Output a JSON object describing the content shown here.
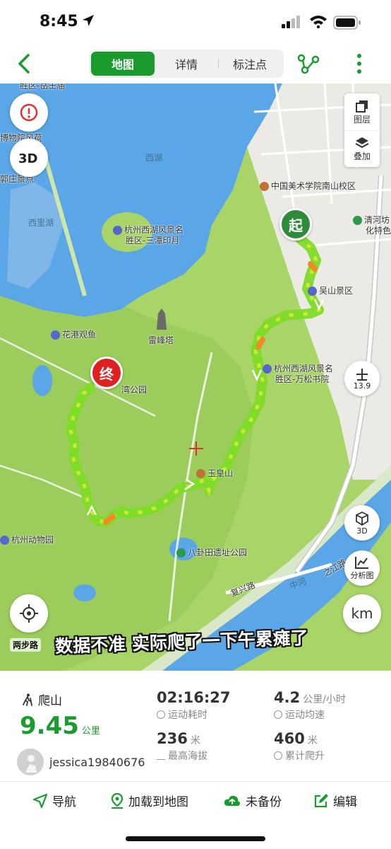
{
  "status_bar": {
    "time": "8:45"
  },
  "header": {
    "tabs": [
      {
        "label": "地图",
        "active": true
      },
      {
        "label": "详情",
        "active": false
      },
      {
        "label": "标注点",
        "active": false
      }
    ]
  },
  "map": {
    "layers_label": "图层",
    "overlay_label": "叠加",
    "zoom_level": "13.9",
    "btn_3d_label": "3D",
    "analysis_label": "分析图",
    "unit_button_label": "km",
    "start_marker": "起",
    "end_marker": "终",
    "caption": "数据不准 实际爬了一下午累瘫了",
    "brand_watermark": "两步路",
    "pois": {
      "academy": "中国美术学院南山校区",
      "wushan": "吴山景区",
      "wansong_1": "杭州西湖风景名",
      "wansong_2": "胜区-万松书院",
      "santan_1": "杭州西湖风景名",
      "santan_2": "胜区-三潭印月",
      "huagang": "花港观鱼",
      "leifeng": "雷峰塔",
      "park_partial": "湾公园",
      "yuhuang": "玉皇山",
      "bagua": "八卦田遗址公园",
      "zoo": "杭州动物园",
      "fuxing": "复兴路",
      "zhijiang": "之江路",
      "river": "中河",
      "xihu": "西湖",
      "xilihu": "西里湖",
      "qinghe_1": "清河坊",
      "qinghe_2": "化特色",
      "top_cut": "胜区-岳王庙",
      "hall_cut": "博物院风荷",
      "guo_cut": "郭庄景点"
    }
  },
  "stats": {
    "sport": "爬山",
    "distance": "9.45",
    "distance_unit": "公里",
    "duration": "02:16:27",
    "duration_label": "运动耗时",
    "avg_speed": "4.2",
    "avg_speed_unit": "公里/小时",
    "avg_speed_label": "运动均速",
    "max_alt": "236",
    "max_alt_unit": "米",
    "max_alt_label": "最高海拔",
    "ascent": "460",
    "ascent_unit": "米",
    "ascent_label": "累计爬升",
    "username": "jessica19840676"
  },
  "toolbar": {
    "navigate": "导航",
    "load_map": "加载到地图",
    "backup": "未备份",
    "edit": "编辑"
  },
  "colors": {
    "brand_green": "#1a9b2e",
    "lake": "#5aa6e6",
    "track": "#7ddc26",
    "end_marker": "#e02020"
  }
}
